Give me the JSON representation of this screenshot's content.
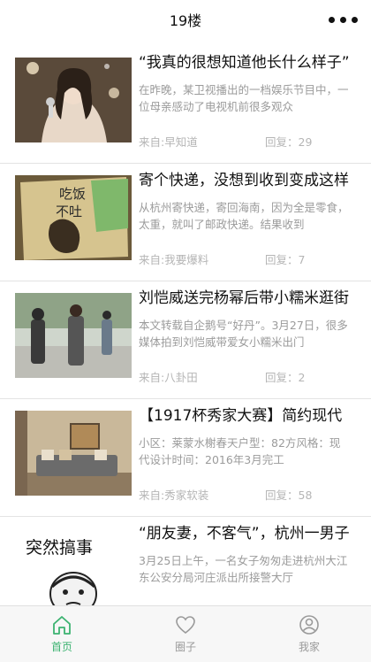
{
  "nav": {
    "title": "19楼"
  },
  "feed": [
    {
      "title": "“我真的很想知道他长什么样子”",
      "summary": "在昨晚，某卫视播出的一档娱乐节目中，一位母亲感动了电视机前很多观众",
      "source": "来自:早知道",
      "replies": "回复：29",
      "thumb_icon": "singer-photo"
    },
    {
      "title": "寄个快递，没想到收到变成这样",
      "summary": "从杭州寄快递，寄回海南，因为全是零食，太重，就叫了邮政快递。结果收到",
      "source": "来自:我要爆料",
      "replies": "回复：7",
      "thumb_icon": "damaged-package-photo"
    },
    {
      "title": "刘恺威送完杨幂后带小糯米逛街",
      "summary": "本文转载自企鹅号“好丹”。3月27日，很多媒体拍到刘恺威带爱女小糯米出门",
      "source": "来自:八卦田",
      "replies": "回复：2",
      "thumb_icon": "street-photo"
    },
    {
      "title": "【1917杯秀家大赛】简约现代",
      "summary": "小区：莱蒙水榭春天户型：82方风格：现代设计时间：2016年3月完工",
      "source": "来自:秀家软装",
      "replies": "回复：58",
      "thumb_icon": "living-room-photo"
    },
    {
      "title": "“朋友妻，不客气”，杭州一男子",
      "summary": "3月25日上午，一名女子匆匆走进杭州大江东公安分局河庄派出所接警大厅",
      "source": "",
      "replies": "",
      "thumb_icon": "meme-photo",
      "thumb_text": "突然搞事"
    }
  ],
  "tabs": [
    {
      "label": "首页",
      "icon": "home-icon",
      "active": true
    },
    {
      "label": "圈子",
      "icon": "heart-icon",
      "active": false
    },
    {
      "label": "我家",
      "icon": "user-icon",
      "active": false
    }
  ],
  "colors": {
    "accent": "#3cb371",
    "muted": "#9b9b9b"
  }
}
